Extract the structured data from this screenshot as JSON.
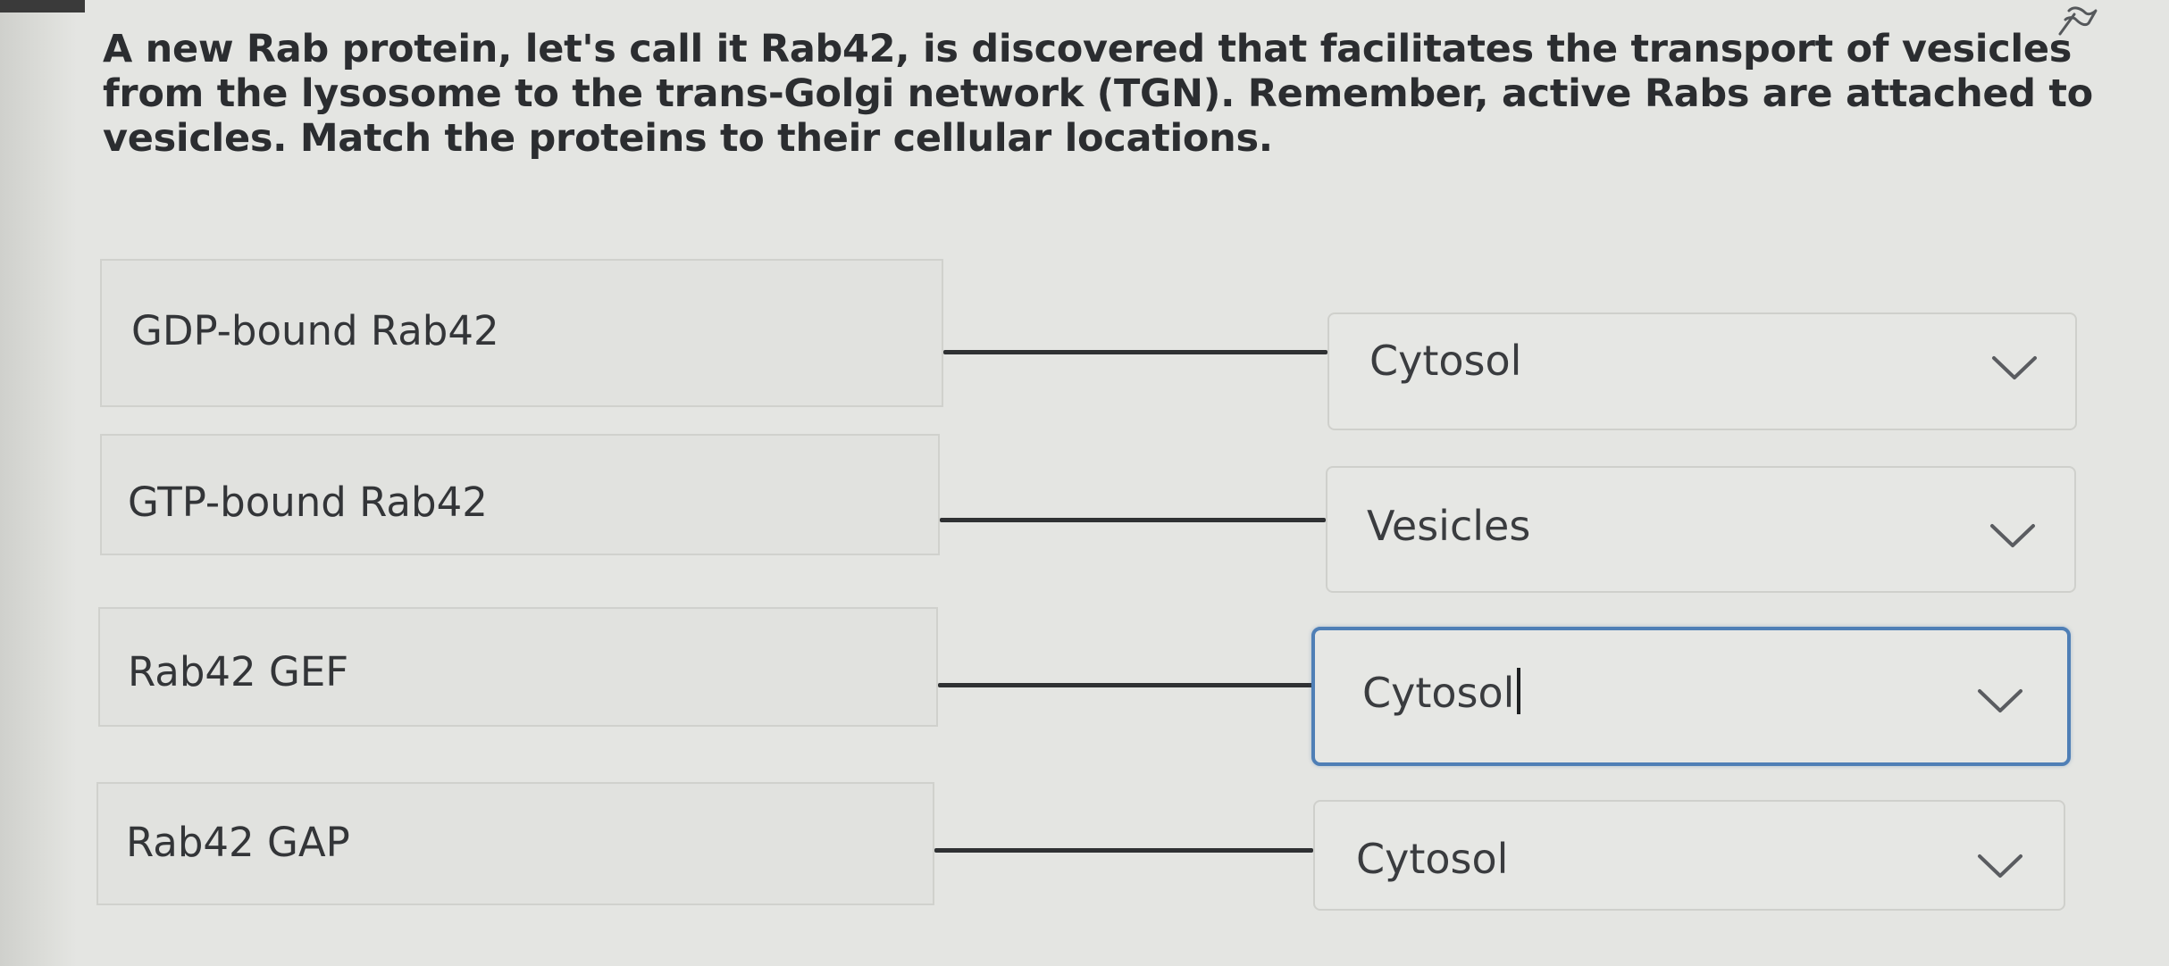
{
  "question": {
    "text": "A new Rab protein, let's call it Rab42, is discovered that facilitates the transport of vesicles from the lysosome to the trans-Golgi network (TGN). Remember, active Rabs are attached to vesicles. Match the proteins to their cellular locations."
  },
  "matches": [
    {
      "term": "GDP-bound Rab42",
      "selected": "Cytosol",
      "focused": false
    },
    {
      "term": "GTP-bound Rab42",
      "selected": "Vesicles",
      "focused": false
    },
    {
      "term": "Rab42 GEF",
      "selected": "Cytosol",
      "focused": true
    },
    {
      "term": "Rab42 GAP",
      "selected": "Cytosol",
      "focused": false
    }
  ],
  "colors": {
    "focus_border": "#4f7fb6",
    "connector": "#2f3133"
  },
  "icons": {
    "flag": "flag-icon",
    "dropdown": "chevron-down-icon"
  }
}
